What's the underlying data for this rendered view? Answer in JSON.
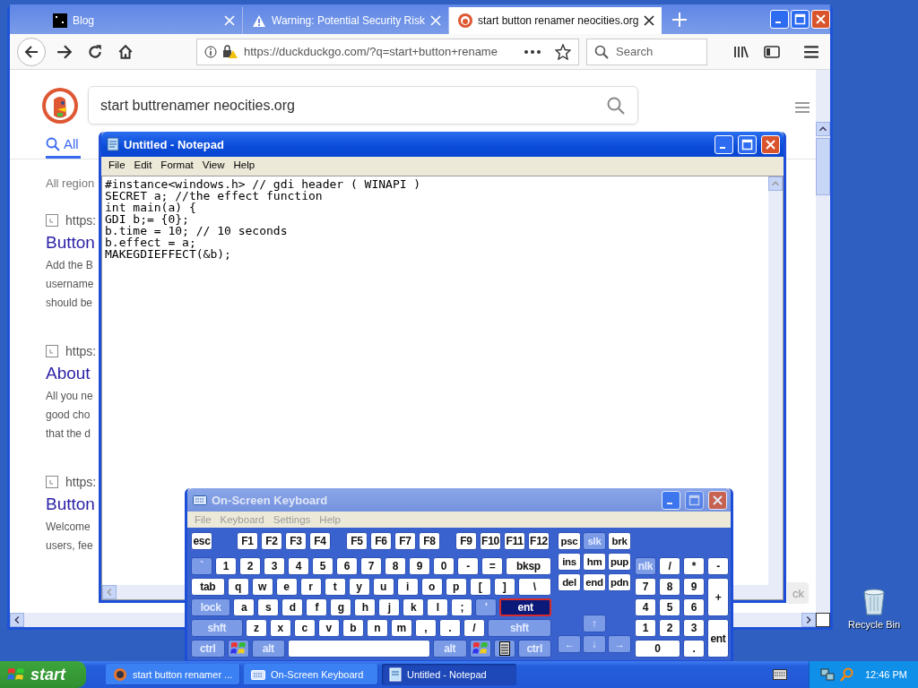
{
  "browser": {
    "tabs": [
      {
        "title": "Blog",
        "kind": "terminal",
        "selected": false
      },
      {
        "title": "Warning: Potential Security Risk",
        "kind": "warning",
        "selected": false
      },
      {
        "title": "start button renamer neocities.org",
        "kind": "duck",
        "selected": true
      }
    ],
    "url": "https://duckduckgo.com/?q=start+button+rename",
    "search_placeholder": "Search",
    "query": "start buttrenamer neocities.org",
    "page_tab": {
      "label": "All",
      "selected": true
    },
    "region": "All region",
    "results": [
      {
        "url": "https:",
        "title": "Button",
        "lines": [
          "Add the B",
          "username",
          "should be"
        ]
      },
      {
        "url": "https:",
        "title": "About",
        "lines": [
          "All you ne",
          "good cho",
          "that the d"
        ]
      },
      {
        "url": "https:",
        "title": "Button",
        "lines": [
          "Welcome",
          "users, fee"
        ]
      }
    ],
    "side_button": "ck"
  },
  "notepad": {
    "title": "Untitled - Notepad",
    "menu": [
      "File",
      "Edit",
      "Format",
      "View",
      "Help"
    ],
    "lines": [
      "#instance<windows.h> // gdi header ( WINAPI )",
      "SECRET a; //the effect function",
      "int main(a) {",
      "GDI b;= {0};",
      "b.time = 10; // 10 seconds",
      "b.effect = a;",
      "MAKEGDIEFFECT(&b);"
    ]
  },
  "keyboard": {
    "title": "On-Screen Keyboard",
    "menu": [
      "File",
      "Keyboard",
      "Settings",
      "Help"
    ],
    "main_rows": [
      [
        {
          "label": "esc",
          "kind": "key"
        },
        {
          "label": "F1",
          "kind": "key"
        },
        {
          "label": "F2",
          "kind": "key"
        },
        {
          "label": "F3",
          "kind": "key"
        },
        {
          "label": "F4",
          "kind": "key"
        },
        {
          "label": "F5",
          "kind": "key"
        },
        {
          "label": "F6",
          "kind": "key"
        },
        {
          "label": "F7",
          "kind": "key"
        },
        {
          "label": "F8",
          "kind": "key"
        },
        {
          "label": "F9",
          "kind": "key"
        },
        {
          "label": "F10",
          "kind": "key"
        },
        {
          "label": "F11",
          "kind": "key"
        },
        {
          "label": "F12",
          "kind": "key"
        }
      ],
      [
        {
          "label": "`",
          "kind": "mod"
        },
        {
          "label": "1",
          "kind": "key"
        },
        {
          "label": "2",
          "kind": "key"
        },
        {
          "label": "3",
          "kind": "key"
        },
        {
          "label": "4",
          "kind": "key"
        },
        {
          "label": "5",
          "kind": "key"
        },
        {
          "label": "6",
          "kind": "key"
        },
        {
          "label": "7",
          "kind": "key"
        },
        {
          "label": "8",
          "kind": "key"
        },
        {
          "label": "9",
          "kind": "key"
        },
        {
          "label": "0",
          "kind": "key"
        },
        {
          "label": "-",
          "kind": "key"
        },
        {
          "label": "=",
          "kind": "key"
        },
        {
          "label": "bksp",
          "kind": "key"
        }
      ],
      [
        {
          "label": "tab",
          "kind": "key"
        },
        {
          "label": "q",
          "kind": "key"
        },
        {
          "label": "w",
          "kind": "key"
        },
        {
          "label": "e",
          "kind": "key"
        },
        {
          "label": "r",
          "kind": "key"
        },
        {
          "label": "t",
          "kind": "key"
        },
        {
          "label": "y",
          "kind": "key"
        },
        {
          "label": "u",
          "kind": "key"
        },
        {
          "label": "i",
          "kind": "key"
        },
        {
          "label": "o",
          "kind": "key"
        },
        {
          "label": "p",
          "kind": "key"
        },
        {
          "label": "[",
          "kind": "key"
        },
        {
          "label": "]",
          "kind": "key"
        },
        {
          "label": "\\",
          "kind": "key"
        }
      ],
      [
        {
          "label": "lock",
          "kind": "mod"
        },
        {
          "label": "a",
          "kind": "key"
        },
        {
          "label": "s",
          "kind": "key"
        },
        {
          "label": "d",
          "kind": "key"
        },
        {
          "label": "f",
          "kind": "key"
        },
        {
          "label": "g",
          "kind": "key"
        },
        {
          "label": "h",
          "kind": "key"
        },
        {
          "label": "j",
          "kind": "key"
        },
        {
          "label": "k",
          "kind": "key"
        },
        {
          "label": "l",
          "kind": "key"
        },
        {
          "label": ";",
          "kind": "key"
        },
        {
          "label": "'",
          "kind": "mod"
        },
        {
          "label": "ent",
          "kind": "hover"
        }
      ],
      [
        {
          "label": "shft",
          "kind": "mod"
        },
        {
          "label": "z",
          "kind": "key"
        },
        {
          "label": "x",
          "kind": "key"
        },
        {
          "label": "c",
          "kind": "key"
        },
        {
          "label": "v",
          "kind": "key"
        },
        {
          "label": "b",
          "kind": "key"
        },
        {
          "label": "n",
          "kind": "key"
        },
        {
          "label": "m",
          "kind": "key"
        },
        {
          "label": ",",
          "kind": "key"
        },
        {
          "label": ".",
          "kind": "key"
        },
        {
          "label": "/",
          "kind": "key"
        },
        {
          "label": "shft",
          "kind": "mod"
        }
      ],
      [
        {
          "label": "ctrl",
          "kind": "mod"
        },
        {
          "kind": "win"
        },
        {
          "label": "alt",
          "kind": "mod"
        },
        {
          "kind": "space"
        },
        {
          "label": "alt",
          "kind": "mod"
        },
        {
          "kind": "win"
        },
        {
          "kind": "menu"
        },
        {
          "label": "ctrl",
          "kind": "mod"
        }
      ]
    ],
    "nav_keys": [
      {
        "label": "psc",
        "kind": "key"
      },
      {
        "label": "slk",
        "kind": "mod"
      },
      {
        "label": "brk",
        "kind": "key"
      },
      {
        "label": "ins",
        "kind": "key"
      },
      {
        "label": "hm",
        "kind": "key"
      },
      {
        "label": "pup",
        "kind": "key"
      },
      {
        "label": "del",
        "kind": "key"
      },
      {
        "label": "end",
        "kind": "key"
      },
      {
        "label": "pdn",
        "kind": "key"
      },
      {
        "label": "↑",
        "kind": "mod"
      },
      {
        "label": "←",
        "kind": "mod"
      },
      {
        "label": "↓",
        "kind": "mod"
      },
      {
        "label": "→",
        "kind": "mod"
      }
    ],
    "numpad_keys": [
      {
        "label": "nlk",
        "kind": "mod"
      },
      {
        "label": "/",
        "kind": "key"
      },
      {
        "label": "*",
        "kind": "key"
      },
      {
        "label": "-",
        "kind": "key"
      },
      {
        "label": "7",
        "kind": "key"
      },
      {
        "label": "8",
        "kind": "key"
      },
      {
        "label": "9",
        "kind": "key"
      },
      {
        "label": "+",
        "kind": "key"
      },
      {
        "label": "4",
        "kind": "key"
      },
      {
        "label": "5",
        "kind": "key"
      },
      {
        "label": "6",
        "kind": "key"
      },
      {
        "label": "1",
        "kind": "key"
      },
      {
        "label": "2",
        "kind": "key"
      },
      {
        "label": "3",
        "kind": "key"
      },
      {
        "label": "ent",
        "kind": "key"
      },
      {
        "label": "0",
        "kind": "key"
      },
      {
        "label": ".",
        "kind": "key"
      }
    ]
  },
  "desktop": {
    "icons": [
      {
        "label": "Recycle Bin"
      }
    ]
  },
  "taskbar": {
    "start": "start",
    "tasks": [
      {
        "label": "start button renamer ...",
        "kind": "browser",
        "selected": false
      },
      {
        "label": "On-Screen Keyboard",
        "kind": "keyboard",
        "selected": false
      },
      {
        "label": "Untitled - Notepad",
        "kind": "notepad",
        "selected": true
      }
    ],
    "clock": "12:46 PM"
  }
}
